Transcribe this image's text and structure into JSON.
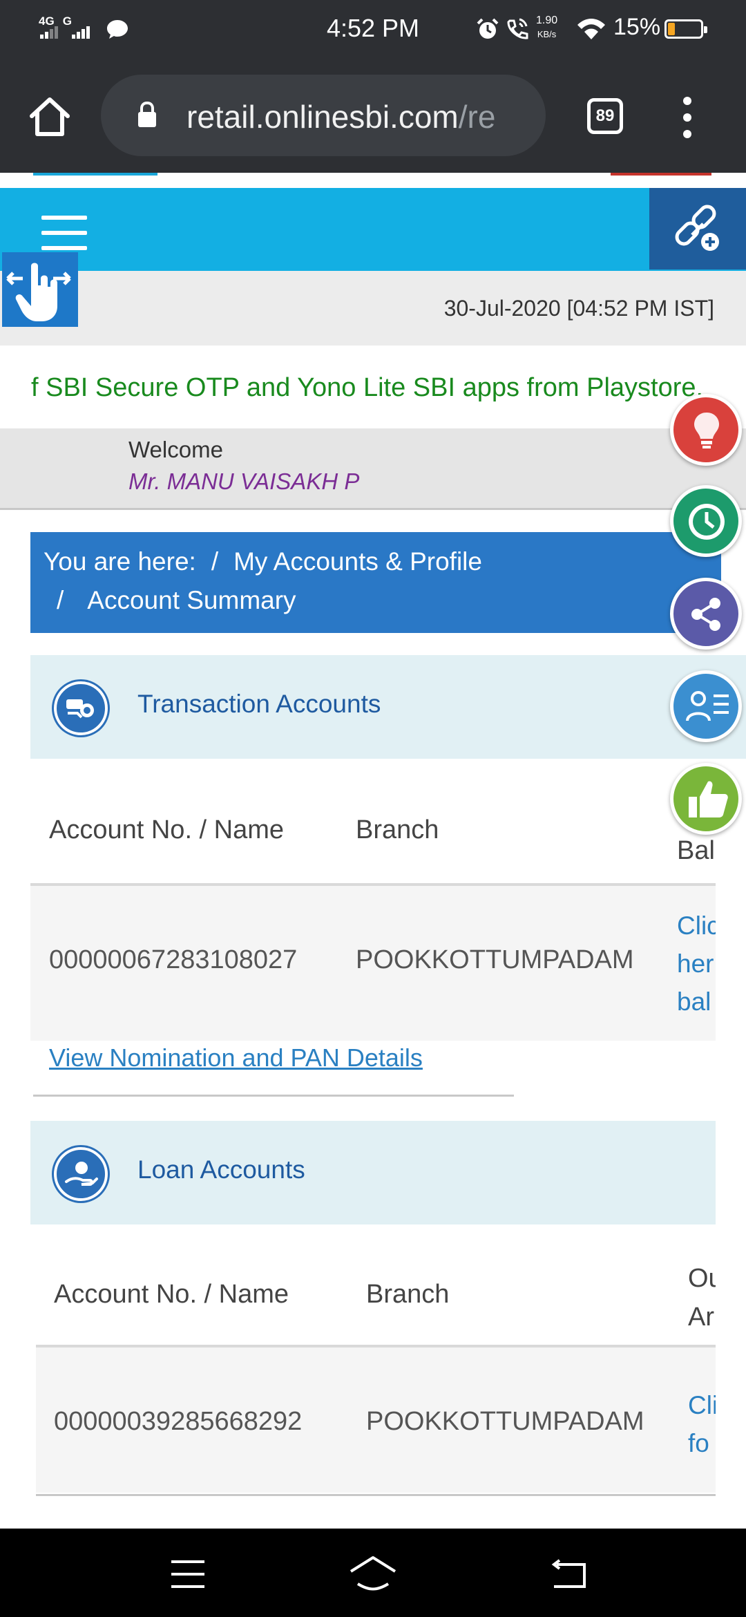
{
  "status_bar": {
    "network_1": "4G",
    "network_2": "G",
    "time": "4:52 PM",
    "speed_value": "1.90",
    "speed_unit": "KB/s",
    "battery": "15%",
    "battery_color": "#f5a623"
  },
  "browser": {
    "url_main": "retail.onlinesbi.com",
    "url_rest": "/re",
    "tab_count": "89"
  },
  "header": {
    "date": "30-Jul-2020 [04:52 PM IST]",
    "ticker": "f SBI Secure OTP and Yono Lite SBI apps from Playstore.",
    "welcome": "Welcome",
    "user_name": "Mr. MANU VAISAKH P"
  },
  "breadcrumb": {
    "prefix": "You are here:",
    "separator": "/",
    "level1": "My Accounts & Profile",
    "level2": "Account Summary"
  },
  "transaction_accounts": {
    "title": "Transaction Accounts",
    "columns": [
      "Account No. / Name",
      "Branch",
      "Bal"
    ],
    "row": {
      "account": "00000067283108027",
      "branch": "POOKKOTTUMPADAM",
      "action": [
        "Clic",
        "her",
        "bal"
      ]
    },
    "nomination_link": "View Nomination and PAN Details"
  },
  "loan_accounts": {
    "title": "Loan Accounts",
    "columns": [
      "Account No. / Name",
      "Branch",
      "Ou",
      "Ar"
    ],
    "row": {
      "account": "00000039285668292",
      "branch": "POOKKOTTUMPADAM",
      "action": [
        "Cli",
        "fo"
      ]
    }
  },
  "floating_buttons": [
    {
      "icon": "lightbulb-icon",
      "color": "#d9413c"
    },
    {
      "icon": "history-icon",
      "color": "#1d9b6c"
    },
    {
      "icon": "share-icon",
      "color": "#5b5aa8"
    },
    {
      "icon": "profile-list-icon",
      "color": "#3b8fd0"
    },
    {
      "icon": "thumbs-up-icon",
      "color": "#7ab63a"
    }
  ],
  "colors": {
    "nav_blue": "#13afe3",
    "breadcrumb_blue": "#2a78c6",
    "ticker_green": "#198a1e",
    "name_purple": "#7b2d95"
  }
}
